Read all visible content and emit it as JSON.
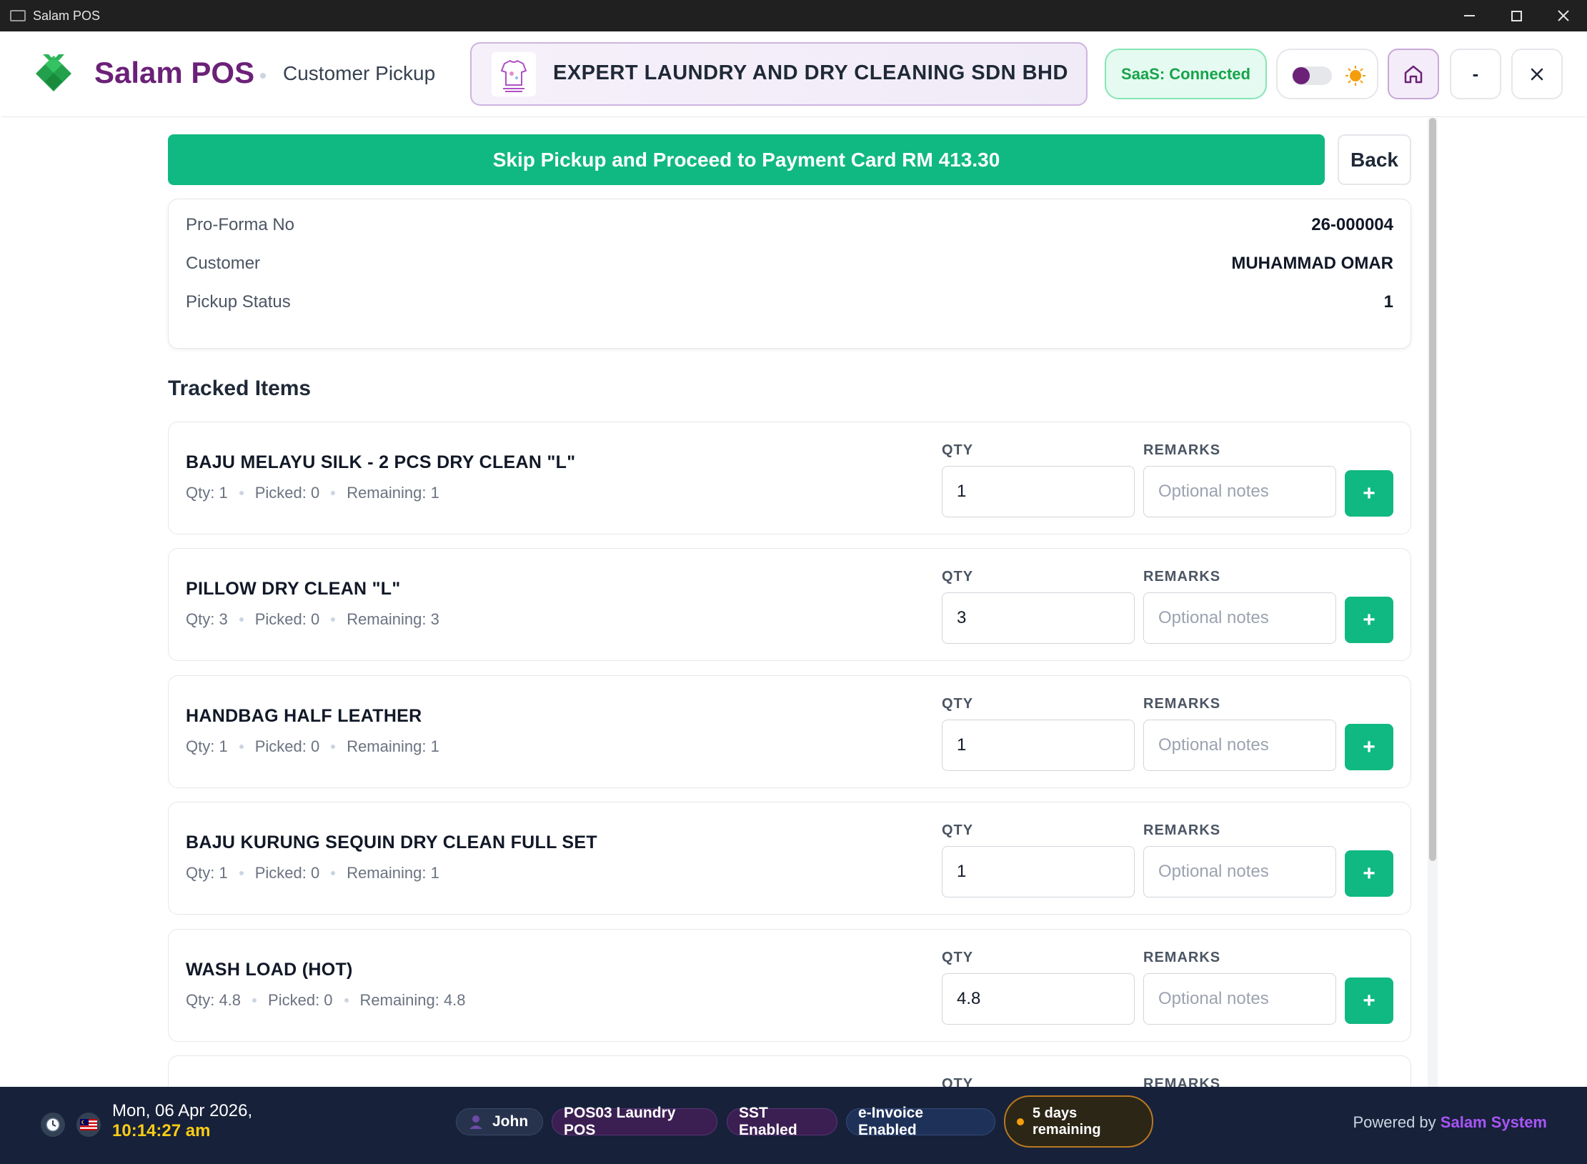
{
  "window": {
    "title": "Salam POS"
  },
  "header": {
    "brand": "Salam POS",
    "page_title": "Customer Pickup",
    "store_name": "EXPERT LAUNDRY AND DRY CLEANING SDN BHD",
    "saas_status": "SaaS: Connected",
    "minimize_label": "-"
  },
  "actions": {
    "skip_label": "Skip Pickup and Proceed to Payment Card RM 413.30",
    "back_label": "Back"
  },
  "info": [
    {
      "label": "Pro-Forma No",
      "value": "26-000004"
    },
    {
      "label": "Customer",
      "value": "MUHAMMAD OMAR"
    },
    {
      "label": "Pickup Status",
      "value": "1"
    }
  ],
  "tracked": {
    "title": "Tracked Items",
    "qty_header": "QTY",
    "remarks_header": "REMARKS",
    "remarks_placeholder": "Optional notes",
    "add_label": "+",
    "items": [
      {
        "name": "BAJU MELAYU SILK - 2 PCS DRY CLEAN \"L\"",
        "qty": "Qty: 1",
        "picked": "Picked: 0",
        "remaining": "Remaining: 1",
        "qty_value": "1"
      },
      {
        "name": "PILLOW DRY CLEAN \"L\"",
        "qty": "Qty: 3",
        "picked": "Picked: 0",
        "remaining": "Remaining: 3",
        "qty_value": "3"
      },
      {
        "name": "HANDBAG HALF LEATHER",
        "qty": "Qty: 1",
        "picked": "Picked: 0",
        "remaining": "Remaining: 1",
        "qty_value": "1"
      },
      {
        "name": "BAJU KURUNG SEQUIN DRY CLEAN FULL SET",
        "qty": "Qty: 1",
        "picked": "Picked: 0",
        "remaining": "Remaining: 1",
        "qty_value": "1"
      },
      {
        "name": "WASH LOAD (HOT)",
        "qty": "Qty: 4.8",
        "picked": "Picked: 0",
        "remaining": "Remaining: 4.8",
        "qty_value": "4.8"
      }
    ]
  },
  "footer": {
    "date": "Mon, 06 Apr 2026,",
    "time": "10:14:27 am",
    "user": "John",
    "pos_name": "POS03 Laundry POS",
    "sst": "SST Enabled",
    "einvoice": "e-Invoice Enabled",
    "days_remaining": "5 days remaining",
    "powered_prefix": "Powered by",
    "powered_brand": "Salam System"
  },
  "colors": {
    "brand_purple": "#6b2178",
    "accent_green": "#10b981",
    "footer_bg": "#17213a",
    "time_yellow": "#facc15"
  }
}
